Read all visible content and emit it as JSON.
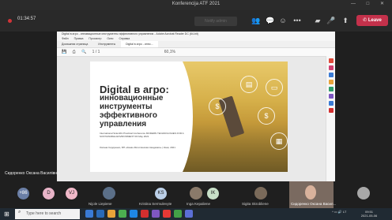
{
  "window": {
    "title": "Konferencija ATF 2021",
    "controls": [
      "—",
      "□",
      "✕"
    ]
  },
  "meeting": {
    "timer": "01:34:57",
    "notify_button": "Notify admin",
    "leave_label": "Leave",
    "toolbar_icons": [
      "participants-icon",
      "chat-icon",
      "reactions-icon",
      "more-icon",
      "camera-icon",
      "mic-icon",
      "share-icon"
    ]
  },
  "acrobat": {
    "title": "Digital в агро - инновационные инструменты эффективного управления - Adobe Acrobat Reader DC (64-bit)",
    "menu": [
      "Файл",
      "Правка",
      "Просмотр",
      "Окно",
      "Справка"
    ],
    "tabs": [
      "Домашняя страница",
      "Инструменты",
      "Digital в агро - инно..."
    ],
    "active_tab": 2,
    "page_counter": "1 / 1",
    "zoom": "60,1%"
  },
  "slide": {
    "title_line1": "Digital в агро:",
    "title_line2": "инновационные",
    "title_line3": "инструменты",
    "title_line4": "эффективного",
    "title_line5": "управления",
    "subtitle": "International Scientific Practical Conference MODERN TECHNOLOGIES FOR A SUSTAINABLE ENVIRONMENT 6th May 2021",
    "author": "Оксана Сидоренко, БП «Киево-Могилянская Академия» | Киев, 2021"
  },
  "presenter_name": "Сидоренко Оксана Василівна",
  "participants": [
    {
      "initials": "+86",
      "color": "#6b7fa6"
    },
    {
      "initials": "D",
      "color": "#e8b4c8"
    },
    {
      "initials": "VJ",
      "color": "#f0b8c8"
    },
    {
      "name": "Nijole Liepiene",
      "color": "#5b6f88"
    },
    {
      "initials": "KS",
      "name": "Kristina Sermulevyte",
      "color": "#bcd0e8"
    },
    {
      "name": "Inga Kepaliene",
      "color": "#8a7a6a"
    },
    {
      "initials": "IK",
      "name": "",
      "color": "#c8e0c8"
    },
    {
      "name": "Sigita Skrobliene",
      "color": "#7a6a5a"
    },
    {
      "name": "Сидоренко Оксана Васил...",
      "color": "#7a6a60"
    },
    {
      "name": "",
      "color": "#a8a8a8"
    }
  ],
  "taskbar": {
    "search_placeholder": "Type here to search",
    "app_colors": [
      "#3a7bd5",
      "#2a6ab8",
      "#e8a33a",
      "#4caf50",
      "#1e88e5",
      "#d32f2f",
      "#7e57c2",
      "#e53935",
      "#43a047",
      "#5b6fd6"
    ],
    "lang": "LT",
    "time": "09:51",
    "date": "2021-05-06"
  }
}
